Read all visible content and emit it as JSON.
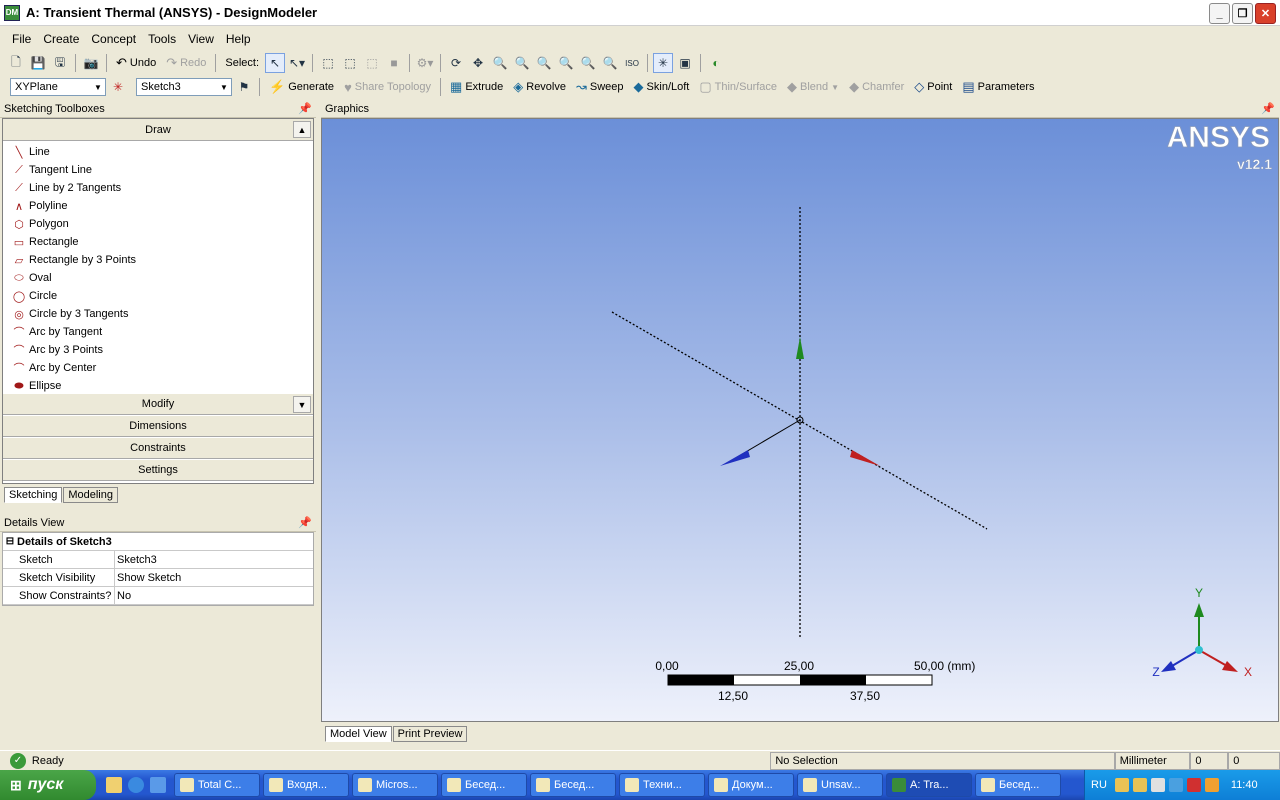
{
  "window": {
    "title": "A: Transient Thermal (ANSYS) - DesignModeler",
    "app_icon": "DM",
    "minimize": "_",
    "maximize": "❐",
    "close": "✕"
  },
  "menu": [
    "File",
    "Create",
    "Concept",
    "Tools",
    "View",
    "Help"
  ],
  "toolbar1": {
    "undo": "Undo",
    "redo": "Redo",
    "select": "Select:"
  },
  "toolbar2": {
    "plane": "XYPlane",
    "sketch": "Sketch3",
    "generate": "Generate",
    "share_topology": "Share Topology",
    "extrude": "Extrude",
    "revolve": "Revolve",
    "sweep": "Sweep",
    "skin_loft": "Skin/Loft",
    "thin_surface": "Thin/Surface",
    "blend": "Blend",
    "chamfer": "Chamfer",
    "point": "Point",
    "parameters": "Parameters"
  },
  "toolbox": {
    "title": "Sketching Toolboxes",
    "draw": "Draw",
    "tools": [
      "Line",
      "Tangent Line",
      "Line by 2 Tangents",
      "Polyline",
      "Polygon",
      "Rectangle",
      "Rectangle by 3 Points",
      "Oval",
      "Circle",
      "Circle by 3 Tangents",
      "Arc by Tangent",
      "Arc by 3 Points",
      "Arc by Center",
      "Ellipse"
    ],
    "modify": "Modify",
    "dimensions": "Dimensions",
    "constraints": "Constraints",
    "settings": "Settings",
    "tab_sketching": "Sketching",
    "tab_modeling": "Modeling"
  },
  "details": {
    "title": "Details View",
    "header": "Details of Sketch3",
    "rows": [
      {
        "k": "Sketch",
        "v": "Sketch3"
      },
      {
        "k": "Sketch Visibility",
        "v": "Show Sketch"
      },
      {
        "k": "Show Constraints?",
        "v": "No"
      }
    ]
  },
  "graphics": {
    "title": "Graphics",
    "logo": "ANSYS",
    "version": "v12.1",
    "scale_top": [
      "0,00",
      "25,00",
      "50,00 (mm)"
    ],
    "scale_bottom": [
      "12,50",
      "37,50"
    ],
    "axes": {
      "x": "X",
      "y": "Y",
      "z": "Z"
    },
    "tab_model": "Model View",
    "tab_print": "Print Preview"
  },
  "status": {
    "ready": "Ready",
    "selection": "No Selection",
    "units": "Millimeter",
    "v1": "0",
    "v2": "0"
  },
  "taskbar": {
    "start": "пуск",
    "apps": [
      "Total C...",
      "Входя...",
      "Micros...",
      "Бесед...",
      "Бесед...",
      "Техни...",
      "Докум...",
      "Unsav...",
      "A: Tra...",
      "Бесед..."
    ],
    "lang": "RU",
    "clock": "11:40"
  },
  "colors": {
    "x_axis": "#d02020",
    "y_axis": "#20a020",
    "z_axis": "#2030c0",
    "graphics_top": "#6b8fd8",
    "graphics_bottom": "#eef1fb"
  }
}
